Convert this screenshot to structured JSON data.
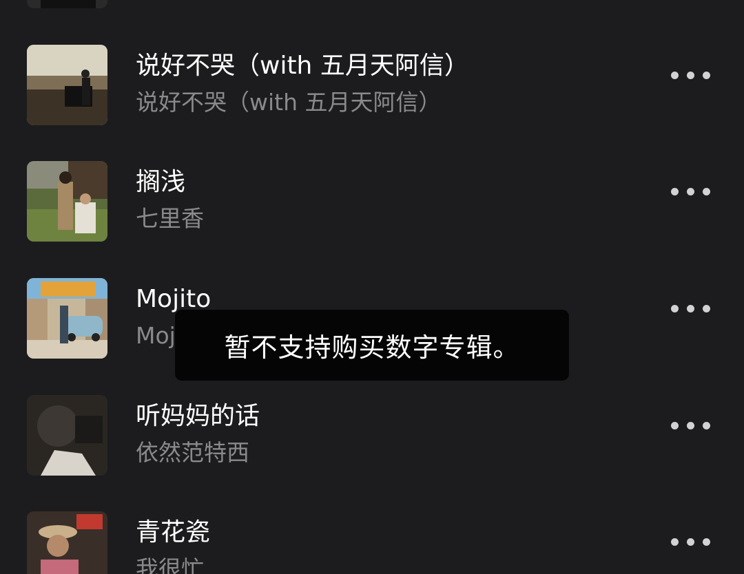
{
  "songs": [
    {
      "title": "说好不哭（with 五月天阿信）",
      "subtitle": "说好不哭（with 五月天阿信）"
    },
    {
      "title": "搁浅",
      "subtitle": "七里香"
    },
    {
      "title": "Mojito",
      "subtitle": "Mojito"
    },
    {
      "title": "听妈妈的话",
      "subtitle": "依然范特西"
    },
    {
      "title": "青花瓷",
      "subtitle": "我很忙"
    }
  ],
  "toast": {
    "message": "暂不支持购买数字专辑。"
  },
  "colors": {
    "background": "#1c1c1e",
    "title": "#ffffff",
    "subtitle": "#8a8a8d",
    "toast_bg": "#050505",
    "more_dots": "#d2d2d4"
  }
}
